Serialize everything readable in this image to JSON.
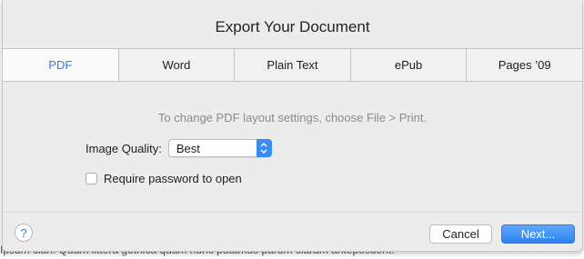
{
  "background": {
    "text": "Ipsum clari. Quam littera gothica quam nunc putamus parum claram anteposuerit."
  },
  "dialog": {
    "title": "Export Your Document",
    "tabs": [
      {
        "label": "PDF",
        "active": true
      },
      {
        "label": "Word",
        "active": false
      },
      {
        "label": "Plain Text",
        "active": false
      },
      {
        "label": "ePub",
        "active": false
      },
      {
        "label": "Pages ’09",
        "active": false
      }
    ],
    "info_text": "To change PDF layout settings, choose File > Print.",
    "image_quality": {
      "label": "Image Quality:",
      "value": "Best"
    },
    "password_option": {
      "label": "Require password to open",
      "checked": false
    },
    "help_glyph": "?",
    "cancel_label": "Cancel",
    "next_label": "Next..."
  },
  "colors": {
    "accent": "#3a7bd5",
    "primary_button": "#3b8cf0",
    "dialog_background": "#ececec"
  },
  "icons": {
    "help": "help-icon",
    "select_arrows": "chevron-updown-icon"
  }
}
